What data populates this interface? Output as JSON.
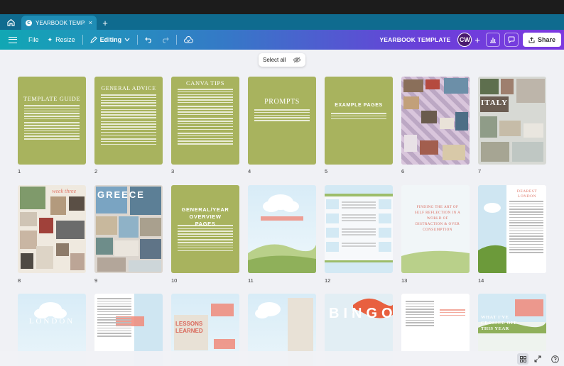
{
  "browser": {
    "tab_title": "YEARBOOK TEMPL…",
    "tab_close": "×",
    "new_tab": "+"
  },
  "toolbar": {
    "file_label": "File",
    "resize_label": "Resize",
    "editing_label": "Editing",
    "doc_title": "YEARBOOK TEMPLATE",
    "avatar_initials": "CW",
    "share_label": "Share"
  },
  "select_all": {
    "label": "Select all"
  },
  "pages": [
    {
      "num": "1",
      "title": "TEMPLATE GUIDE"
    },
    {
      "num": "2",
      "title": "GENERAL ADVICE"
    },
    {
      "num": "3",
      "title": "CANVA TIPS"
    },
    {
      "num": "4",
      "title": "PROMPTS"
    },
    {
      "num": "5",
      "title": "EXAMPLE PAGES"
    },
    {
      "num": "6",
      "title": ""
    },
    {
      "num": "7",
      "title": "ITALY"
    },
    {
      "num": "8",
      "title": "week three"
    },
    {
      "num": "9",
      "title": "GREECE"
    },
    {
      "num": "10",
      "title": "GENERAL/YEAR OVERVIEW PAGES"
    },
    {
      "num": "11",
      "title": ""
    },
    {
      "num": "12",
      "title": ""
    },
    {
      "num": "13",
      "title": "FINDING THE ART OF SELF REFLECTION IN A WORLD OF DISTRACTION & OVER CONSUMPTION"
    },
    {
      "num": "14",
      "title": "DEAREST LONDON"
    },
    {
      "num": "",
      "title": "LONDON"
    },
    {
      "num": "",
      "title": ""
    },
    {
      "num": "",
      "title": "LESSONS LEARNED"
    },
    {
      "num": "",
      "title": ""
    },
    {
      "num": "",
      "title": "BINGO"
    },
    {
      "num": "",
      "title": ""
    },
    {
      "num": "",
      "title": ""
    },
    {
      "num": "",
      "title": "WHAT I'VE CROSSED OFF THIS YEAR"
    }
  ],
  "colors": {
    "olive": "#a8b35e",
    "tab_teal": "#1f8db5",
    "toolbar_start": "#11a7b4",
    "toolbar_end": "#7b3ae0",
    "coral": "#f08a7a"
  }
}
